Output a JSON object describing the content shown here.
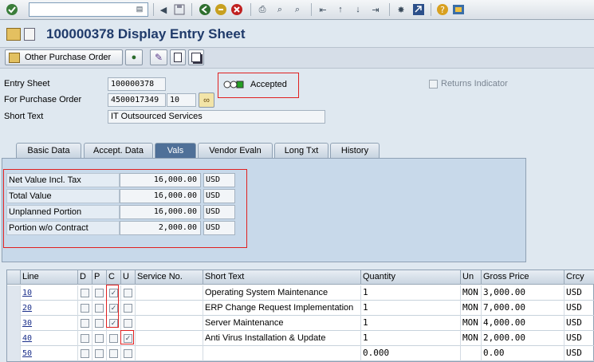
{
  "toolbar": {
    "command_value": ""
  },
  "title": {
    "text": "100000378 Display Entry Sheet"
  },
  "app_toolbar": {
    "other_po_label": "Other Purchase Order"
  },
  "header": {
    "entry_sheet_label": "Entry Sheet",
    "entry_sheet_value": "100000378",
    "status_text": "Accepted",
    "returns_indicator_label": "Returns Indicator",
    "po_label": "For Purchase Order",
    "po_value": "4500017349",
    "po_item_value": "10",
    "short_text_label": "Short Text",
    "short_text_value": "IT Outsourced Services"
  },
  "tabs": [
    {
      "label": "Basic Data"
    },
    {
      "label": "Accept. Data"
    },
    {
      "label": "Vals"
    },
    {
      "label": "Vendor Evaln"
    },
    {
      "label": "Long Txt"
    },
    {
      "label": "History"
    }
  ],
  "active_tab": "Vals",
  "values": [
    {
      "label": "Net Value Incl. Tax",
      "amount": "16,000.00",
      "currency": "USD"
    },
    {
      "label": "Total Value",
      "amount": "16,000.00",
      "currency": "USD"
    },
    {
      "label": "Unplanned Portion",
      "amount": "16,000.00",
      "currency": "USD"
    },
    {
      "label": "Portion w/o Contract",
      "amount": "2,000.00",
      "currency": "USD"
    }
  ],
  "table": {
    "columns": [
      "Line",
      "D",
      "P",
      "C",
      "U",
      "Service No.",
      "Short Text",
      "Quantity",
      "Un",
      "Gross Price",
      "Crcy"
    ],
    "rows": [
      {
        "line": "10",
        "d": false,
        "p": false,
        "c": true,
        "u": false,
        "service_no": "",
        "short_text": "Operating System Maintenance",
        "quantity": "1",
        "unit": "MON",
        "gross_price": "3,000.00",
        "currency": "USD"
      },
      {
        "line": "20",
        "d": false,
        "p": false,
        "c": true,
        "u": false,
        "service_no": "",
        "short_text": "ERP Change Request Implementation",
        "quantity": "1",
        "unit": "MON",
        "gross_price": "7,000.00",
        "currency": "USD"
      },
      {
        "line": "30",
        "d": false,
        "p": false,
        "c": true,
        "u": false,
        "service_no": "",
        "short_text": "Server Maintenance",
        "quantity": "1",
        "unit": "MON",
        "gross_price": "4,000.00",
        "currency": "USD"
      },
      {
        "line": "40",
        "d": false,
        "p": false,
        "c": false,
        "u": true,
        "service_no": "",
        "short_text": "Anti Virus Installation & Update",
        "quantity": "1",
        "unit": "MON",
        "gross_price": "2,000.00",
        "currency": "USD"
      },
      {
        "line": "50",
        "d": false,
        "p": false,
        "c": false,
        "u": false,
        "service_no": "",
        "short_text": "",
        "quantity": "0.000",
        "unit": "",
        "gross_price": "0.00",
        "currency": "USD"
      }
    ]
  },
  "colors": {
    "title": "#1f3a6a",
    "highlight_box": "#e02020",
    "active_tab": "#4f7098"
  }
}
